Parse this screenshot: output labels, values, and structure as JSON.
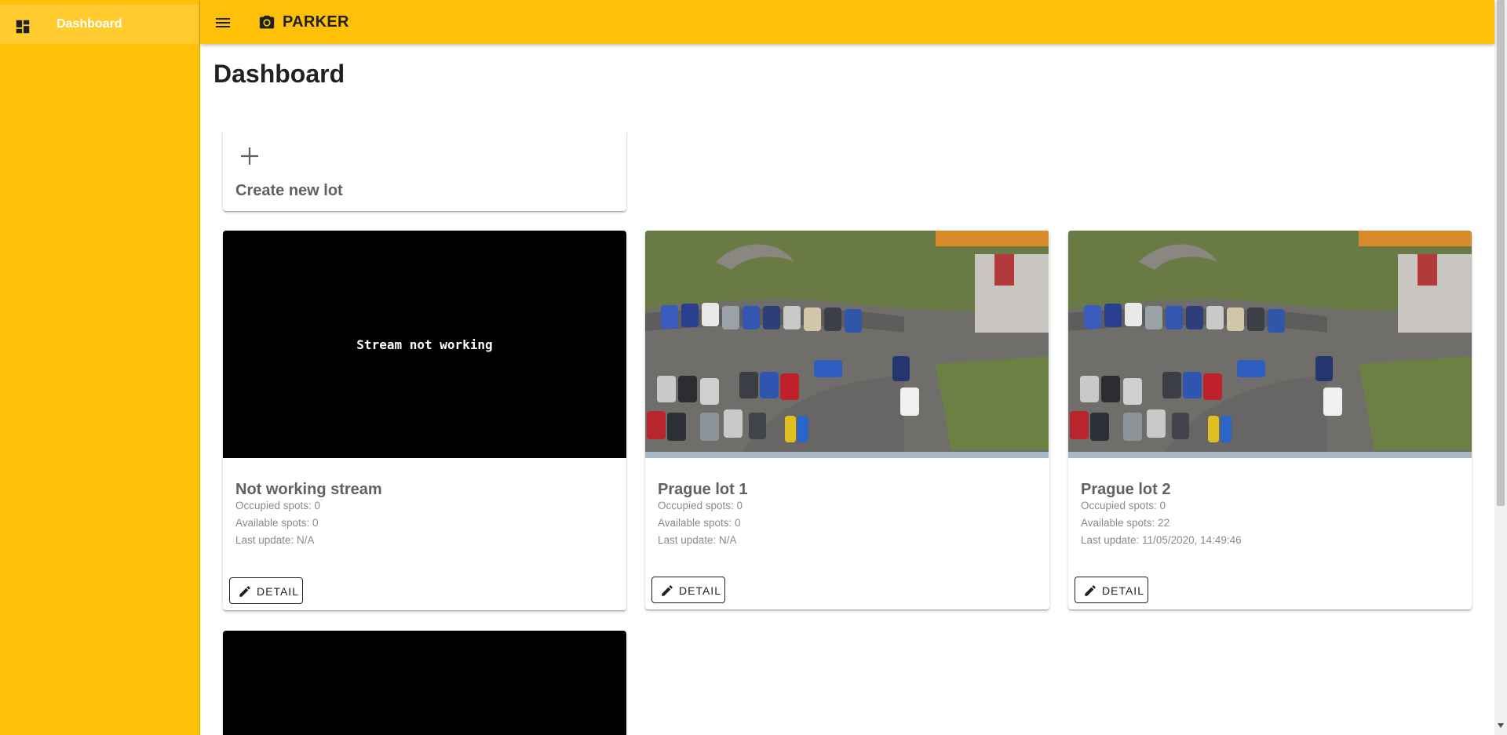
{
  "sidebar": {
    "items": [
      {
        "label": "Dashboard",
        "icon": "dashboard-icon"
      }
    ]
  },
  "header": {
    "brand": "PARKER",
    "menu_icon": "menu-icon",
    "logo_icon": "camera-icon"
  },
  "colors": {
    "accent": "#ffc107",
    "text": "#212121",
    "muted": "#616161"
  },
  "page": {
    "title": "Dashboard"
  },
  "create_card": {
    "label": "Create new lot",
    "icon": "plus-icon"
  },
  "lots": [
    {
      "name": "Not working stream",
      "stream_text": "Stream not working",
      "occupied": "Occupied spots: 0",
      "available": "Available spots: 0",
      "last_update": "Last update: N/A",
      "button": "DETAIL"
    },
    {
      "name": "Prague lot 1",
      "occupied": "Occupied spots: 0",
      "available": "Available spots: 0",
      "last_update": "Last update: N/A",
      "button": "DETAIL"
    },
    {
      "name": "Prague lot 2",
      "occupied": "Occupied spots: 0",
      "available": "Available spots: 22",
      "last_update": "Last update: 11/05/2020, 14:49:46",
      "button": "DETAIL"
    }
  ]
}
